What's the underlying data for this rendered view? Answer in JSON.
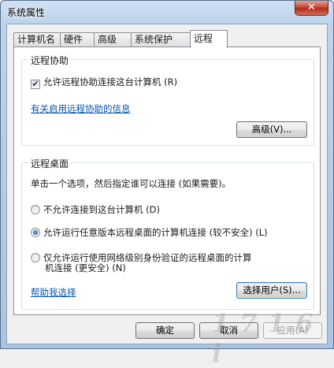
{
  "window": {
    "title": "系统属性",
    "close_glyph": "✕"
  },
  "tabs": [
    {
      "label": "计算机名"
    },
    {
      "label": "硬件"
    },
    {
      "label": "高级"
    },
    {
      "label": "系统保护"
    },
    {
      "label": "远程",
      "active": true
    }
  ],
  "remote_assistance": {
    "group_title": "远程协助",
    "allow_checkbox_label": "允许远程协助连接这台计算机 (R)",
    "allow_checked": true,
    "check_glyph": "✔",
    "info_link": "有关启用远程协助的信息",
    "advanced_button": "高级(V)..."
  },
  "remote_desktop": {
    "group_title": "远程桌面",
    "instruction": "单击一个选项，然后指定谁可以连接 (如果需要)。",
    "options": [
      {
        "label": "不允许连接到这台计算机 (D)",
        "selected": false
      },
      {
        "label": "允许运行任意版本远程桌面的计算机连接 (较不安全) (L)",
        "selected": true
      },
      {
        "label_line1": "仅允许运行使用网络级别身份验证的远程桌面的计算",
        "label_line2": "机连接 (更安全) (N)",
        "selected": false
      }
    ],
    "help_link": "帮助我选择",
    "select_users_button": "选择用户(S)..."
  },
  "footer": {
    "ok_button": "确定",
    "cancel_button": "取消",
    "apply_button": "应用(A)"
  },
  "watermark": "1 7 1 6 i"
}
